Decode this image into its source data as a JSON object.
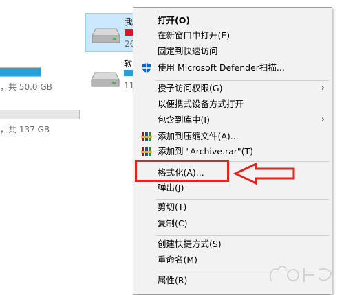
{
  "drives": {
    "c": {
      "size_text": "，共 50.0 GB",
      "used_fraction": 0.51
    },
    "d": {
      "size_text": "，共 137 GB",
      "used_fraction": 0.0
    },
    "tile1": {
      "name": "我",
      "sub": "26",
      "bar_color": "#e81123"
    },
    "tile2": {
      "name": "软",
      "sub": "11",
      "bar_color": "#26a0da"
    }
  },
  "menu": {
    "open": "打开(O)",
    "open_new_window": "在新窗口中打开(E)",
    "pin_quick_access": "固定到快速访问",
    "defender": "使用 Microsoft Defender扫描...",
    "grant_access": "授予访问权限(G)",
    "open_portable": "以便携式设备方式打开",
    "include_library": "包含到库中(I)",
    "add_archive": "添加到压缩文件(A)...",
    "add_archive_rar": "添加到 \"Archive.rar\"(T)",
    "format": "格式化(A)...",
    "eject": "弹出(J)",
    "cut": "剪切(T)",
    "copy": "复制(C)",
    "create_shortcut": "创建快捷方式(S)",
    "rename": "重命名(M)",
    "properties": "属性(R)"
  },
  "icons": {
    "defender": "defender-shield-icon",
    "winrar": "winrar-books-icon",
    "submenu": "chevron-right-icon"
  },
  "annotation_color": "#e8231e"
}
